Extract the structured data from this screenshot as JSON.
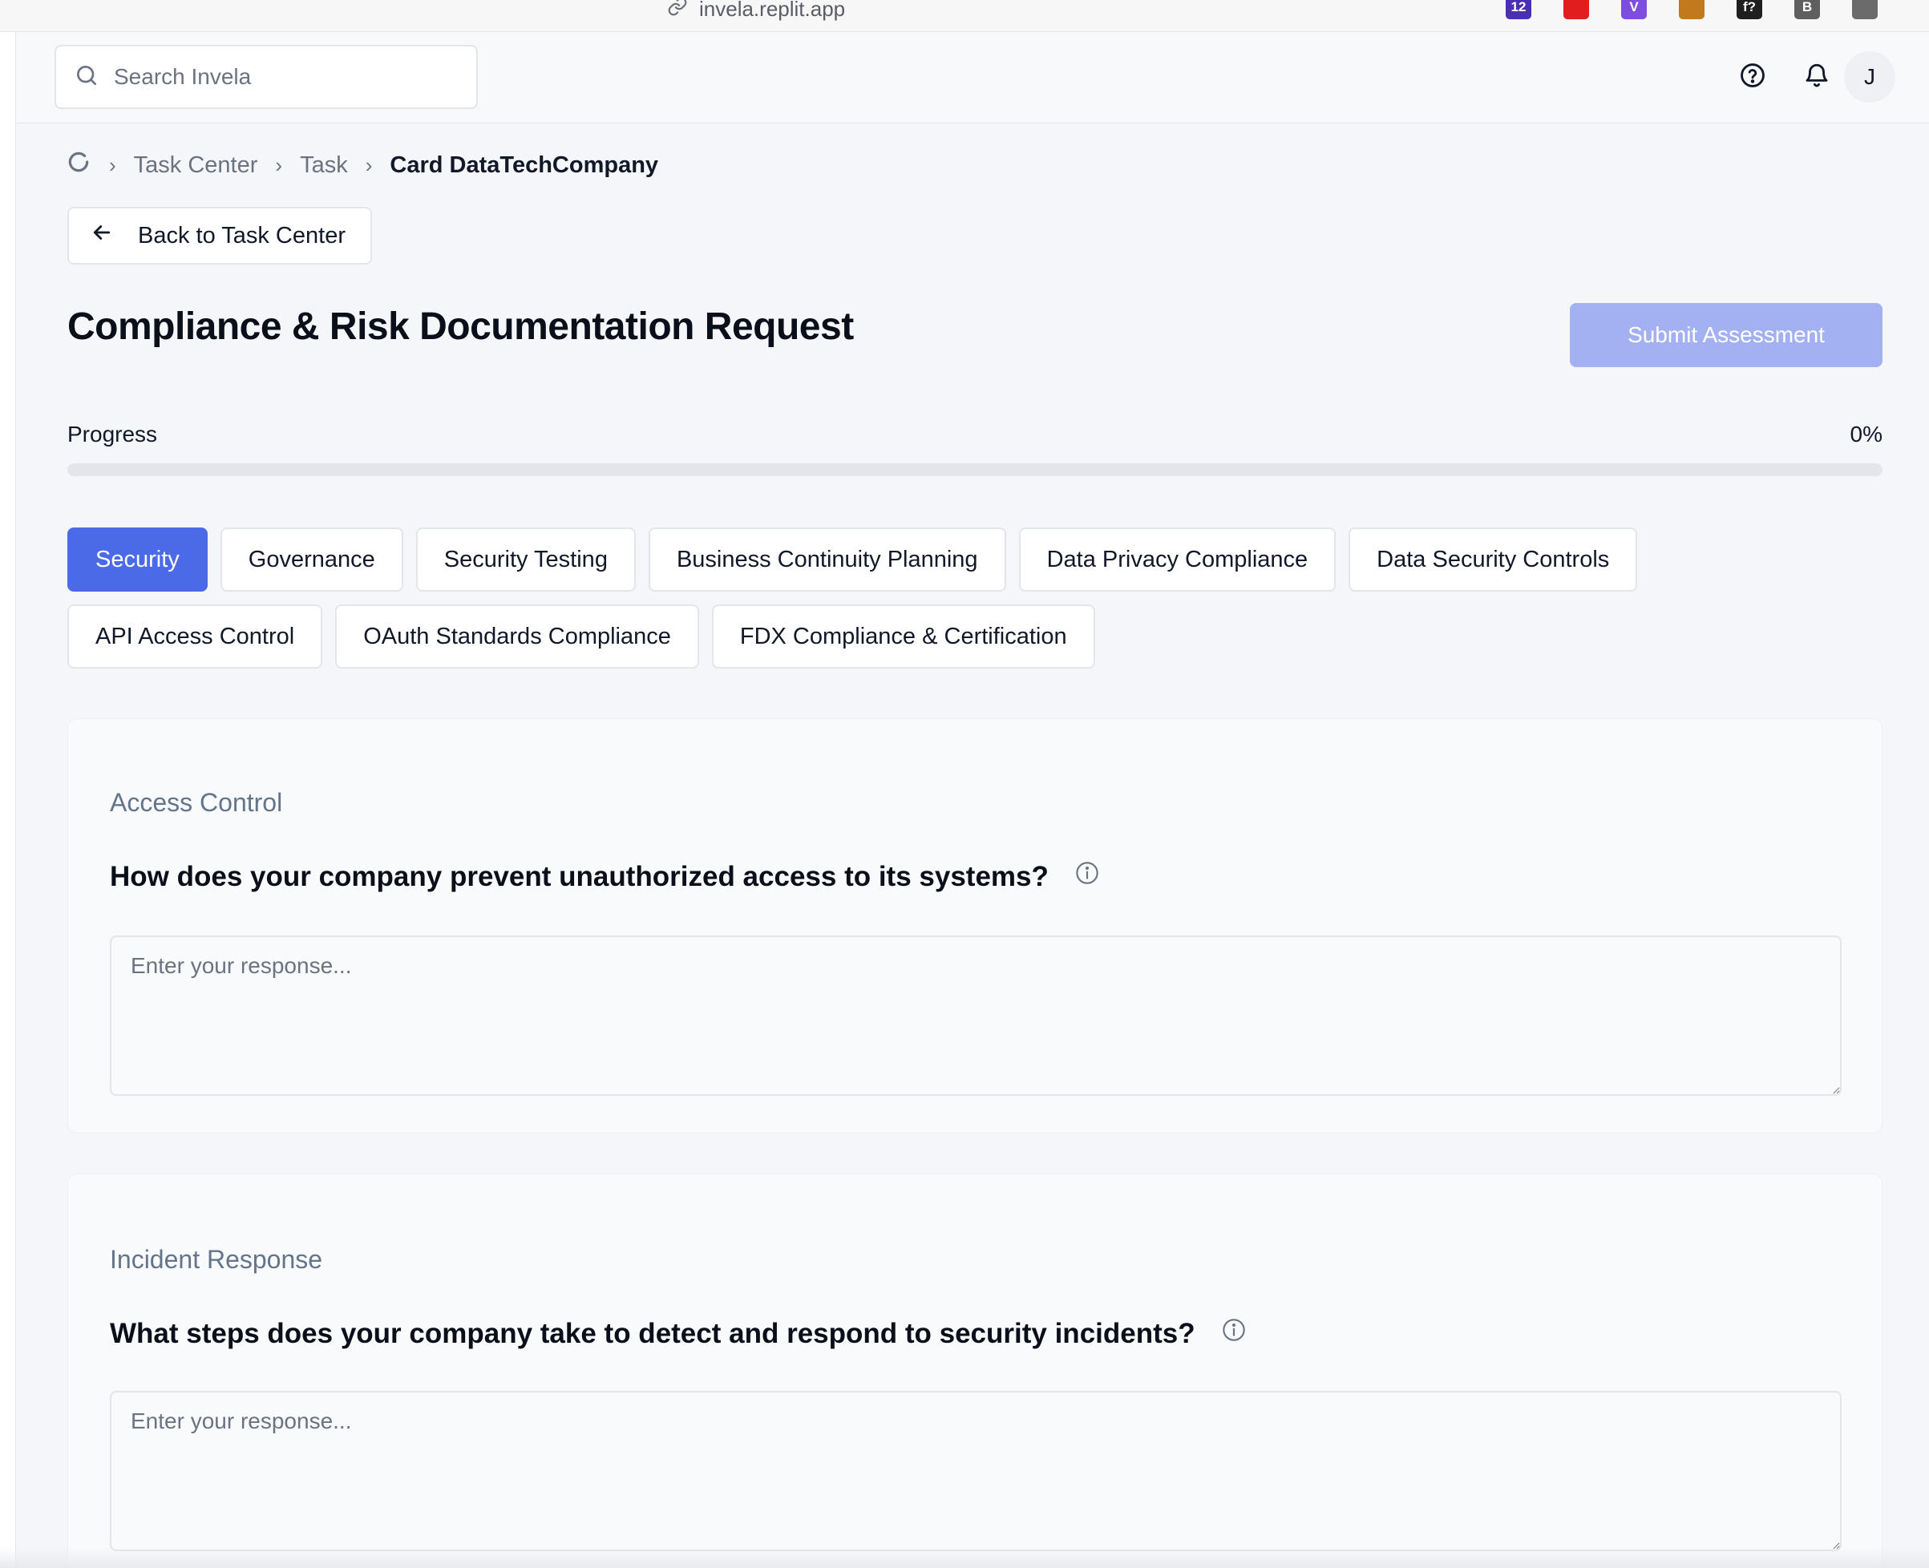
{
  "browser": {
    "url": "invela.replit.app",
    "extensions": [
      {
        "name": "calendar-extension-icon",
        "label": "12",
        "color": "#4a2fb5"
      },
      {
        "name": "adblock-extension-icon",
        "label": "",
        "color": "#e11d1d"
      },
      {
        "name": "v-extension-icon",
        "label": "V",
        "color": "#7c4dde"
      },
      {
        "name": "box-extension-icon",
        "label": "",
        "color": "#c2781d"
      },
      {
        "name": "fx-extension-icon",
        "label": "f?",
        "color": "#1f1f1f"
      },
      {
        "name": "b-extension-icon",
        "label": "B",
        "color": "#5f5f5f"
      },
      {
        "name": "sliders-extension-icon",
        "label": "",
        "color": "#6b6b6b"
      }
    ]
  },
  "header": {
    "search_placeholder": "Search Invela",
    "avatar_initial": "J"
  },
  "breadcrumb": {
    "items": [
      "Task Center",
      "Task"
    ],
    "current": "Card DataTechCompany"
  },
  "back_button": "Back to Task Center",
  "page_title": "Compliance & Risk Documentation Request",
  "submit_button": "Submit Assessment",
  "progress": {
    "label": "Progress",
    "value_text": "0%",
    "value": 0
  },
  "tabs": [
    {
      "label": "Security",
      "active": true
    },
    {
      "label": "Governance",
      "active": false
    },
    {
      "label": "Security Testing",
      "active": false
    },
    {
      "label": "Business Continuity Planning",
      "active": false
    },
    {
      "label": "Data Privacy Compliance",
      "active": false
    },
    {
      "label": "Data Security Controls",
      "active": false
    },
    {
      "label": "API Access Control",
      "active": false
    },
    {
      "label": "OAuth Standards Compliance",
      "active": false
    },
    {
      "label": "FDX Compliance & Certification",
      "active": false
    }
  ],
  "questions": [
    {
      "section": "Access Control",
      "question": "How does your company prevent unauthorized access to its systems?",
      "placeholder": "Enter your response...",
      "value": ""
    },
    {
      "section": "Incident Response",
      "question": "What steps does your company take to detect and respond to security incidents?",
      "placeholder": "Enter your response...",
      "value": ""
    }
  ],
  "colors": {
    "accent": "#4a6ae8",
    "submit_disabled": "#a3b1f2",
    "muted_text": "#6b7280"
  }
}
